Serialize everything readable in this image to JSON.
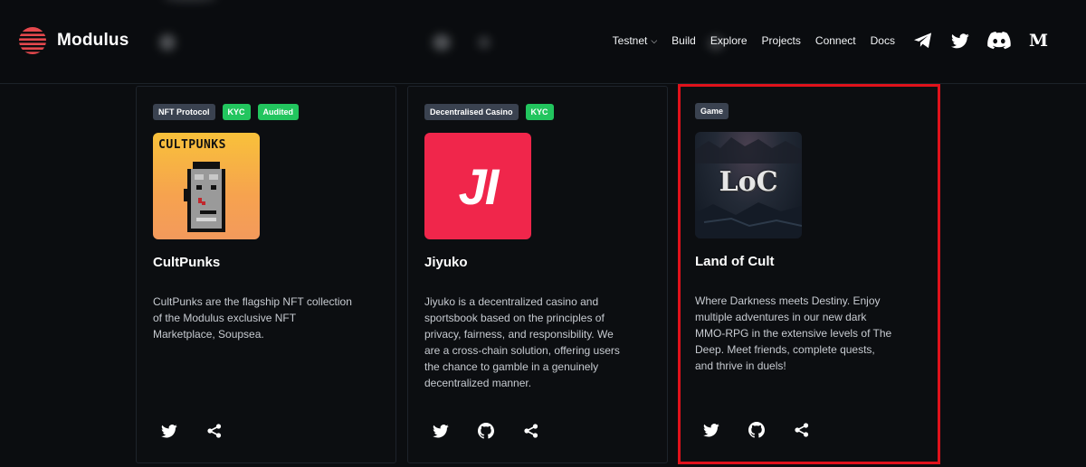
{
  "brand": {
    "name": "Modulus",
    "accent": "#e5484d"
  },
  "nav": {
    "items": [
      {
        "label": "Testnet",
        "has_dropdown": true
      },
      {
        "label": "Build"
      },
      {
        "label": "Explore"
      },
      {
        "label": "Projects"
      },
      {
        "label": "Connect"
      },
      {
        "label": "Docs"
      }
    ],
    "icons": [
      "telegram-icon",
      "twitter-icon",
      "discord-icon",
      "medium-icon"
    ],
    "medium_glyph": "M"
  },
  "cards": [
    {
      "tags": [
        {
          "label": "NFT Protocol",
          "color": "#3a4250"
        },
        {
          "label": "KYC",
          "color": "#22c55e"
        },
        {
          "label": "Audited",
          "color": "#22c55e"
        }
      ],
      "image_text": "CULTPUNKS",
      "title": "CultPunks",
      "description": "CultPunks are the flagship NFT collection of the Modulus exclusive NFT Marketplace, Soupsea.",
      "actions": [
        "twitter-icon",
        "share-icon"
      ]
    },
    {
      "tags": [
        {
          "label": "Decentralised Casino",
          "color": "#3a4250"
        },
        {
          "label": "KYC",
          "color": "#22c55e"
        }
      ],
      "image_text": "JI",
      "title": "Jiyuko",
      "description": "Jiyuko is a decentralized casino and sportsbook based on the principles of privacy, fairness, and responsibility. We are a cross-chain solution, offering users the chance to gamble in a genuinely decentralized manner.",
      "actions": [
        "twitter-icon",
        "github-icon",
        "share-icon"
      ]
    },
    {
      "tags": [
        {
          "label": "Game",
          "color": "#3a4250"
        }
      ],
      "image_text": "LoC",
      "title": "Land of Cult",
      "description": "Where Darkness meets Destiny. Enjoy multiple adventures in our new dark MMO-RPG in the extensive levels of The Deep. Meet friends, complete quests, and thrive in duels!",
      "actions": [
        "twitter-icon",
        "github-icon",
        "share-icon"
      ],
      "highlighted": true,
      "highlight_color": "#e0121b"
    }
  ]
}
